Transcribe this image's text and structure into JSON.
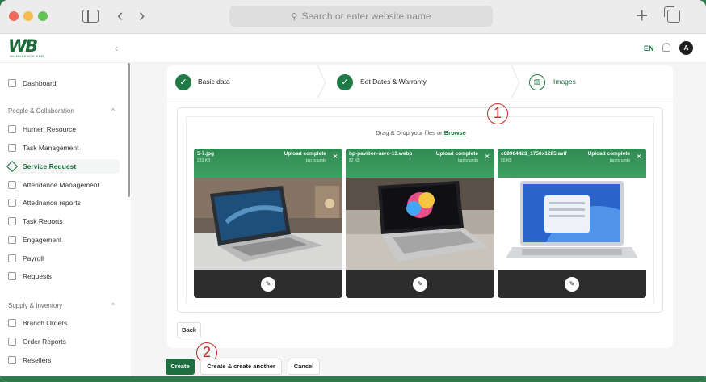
{
  "browser": {
    "url_placeholder": "Search or enter website name"
  },
  "header": {
    "logo_text": "WB",
    "logo_sub": "WORKBENCH ERP",
    "language": "EN",
    "avatar_initial": "A"
  },
  "sidebar": {
    "items": [
      {
        "label": "Dashboard"
      },
      {
        "label": "Humen Resource"
      },
      {
        "label": "Task Management"
      },
      {
        "label": "Service Request"
      },
      {
        "label": "Attendance Management"
      },
      {
        "label": "Attednance reports"
      },
      {
        "label": "Task Reports"
      },
      {
        "label": "Engagement"
      },
      {
        "label": "Payroll"
      },
      {
        "label": "Requests"
      },
      {
        "label": "Branch Orders"
      },
      {
        "label": "Order Reports"
      },
      {
        "label": "Resellers"
      }
    ],
    "sections": [
      {
        "label": "People & Collaboration"
      },
      {
        "label": "Supply & Inventory"
      }
    ],
    "active": "Service Request"
  },
  "steps": [
    {
      "label": "Basic data",
      "state": "done"
    },
    {
      "label": "Set Dates & Warranty",
      "state": "done"
    },
    {
      "label": "Images",
      "state": "current"
    }
  ],
  "dropzone": {
    "prompt": "Drag & Drop your files or",
    "browse": "Browse"
  },
  "files": [
    {
      "name": "5-7.jpg",
      "size": "233 KB",
      "status": "Upload complete",
      "hint": "tap to undo"
    },
    {
      "name": "hp-pavilion-aero-13.webp",
      "size": "82 KB",
      "status": "Upload complete",
      "hint": "tap to undo"
    },
    {
      "name": "c08964423_1750x1285.avif",
      "size": "50 KB",
      "status": "Upload complete",
      "hint": "tap to undo"
    }
  ],
  "buttons": {
    "back": "Back",
    "create": "Create",
    "create_another": "Create & create another",
    "cancel": "Cancel"
  },
  "annotations": [
    "1",
    "2"
  ],
  "colors": {
    "brand": "#1f6e40",
    "accent_green": "#3fa062",
    "annotation": "#c62828"
  }
}
